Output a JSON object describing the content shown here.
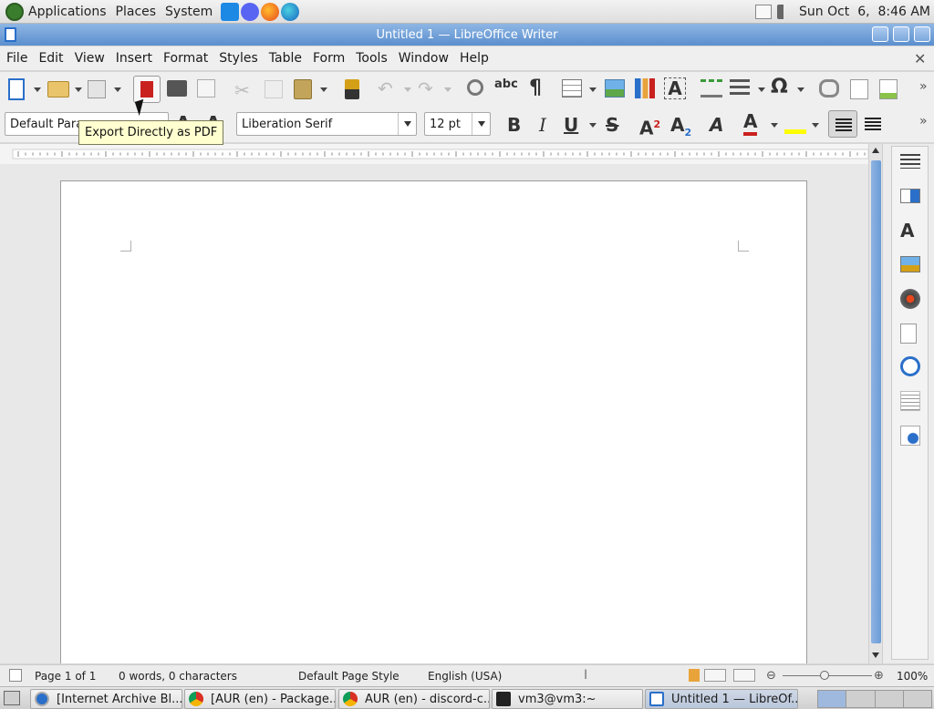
{
  "top_panel": {
    "menus": [
      "Applications",
      "Places",
      "System"
    ],
    "clock": "Sun Oct  6,  8:46 AM"
  },
  "window": {
    "title": "Untitled 1 — LibreOffice Writer"
  },
  "menubar": [
    "File",
    "Edit",
    "View",
    "Insert",
    "Format",
    "Styles",
    "Table",
    "Form",
    "Tools",
    "Window",
    "Help"
  ],
  "formatting": {
    "paragraph_style": "Default Para",
    "font_name": "Liberation Serif",
    "font_size": "12 pt"
  },
  "tooltip": "Export Directly as PDF",
  "statusbar": {
    "page": "Page 1 of 1",
    "words": "0 words, 0 characters",
    "page_style": "Default Page Style",
    "language": "English (USA)",
    "zoom": "100%"
  },
  "taskbar": [
    {
      "label": "[Internet Archive Bl...",
      "icon": "browser-icon"
    },
    {
      "label": "[AUR (en) - Package...",
      "icon": "chrome-icon"
    },
    {
      "label": "AUR (en) - discord-c...",
      "icon": "chrome-icon"
    },
    {
      "label": "vm3@vm3:~",
      "icon": "terminal-icon"
    },
    {
      "label": "Untitled 1 — LibreOf...",
      "icon": "writer-icon"
    }
  ],
  "colors": {
    "titlebar": "#6b9bd6",
    "font_color": "#c9211e",
    "highlight": "#ffff00"
  }
}
